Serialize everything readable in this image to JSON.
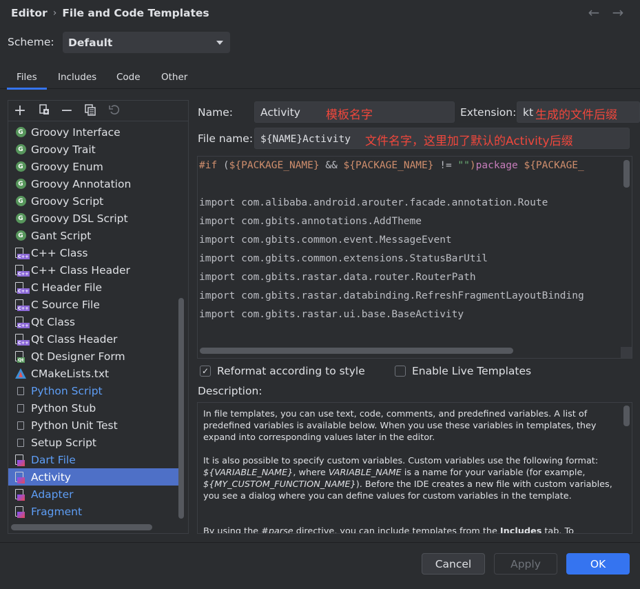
{
  "header": {
    "section": "Editor",
    "separator": "›",
    "page": "File and Code Templates",
    "back_icon": "←",
    "forward_icon": "→"
  },
  "scheme": {
    "label": "Scheme:",
    "value": "Default"
  },
  "tabs": [
    {
      "label": "Files"
    },
    {
      "label": "Includes"
    },
    {
      "label": "Code"
    },
    {
      "label": "Other"
    }
  ],
  "toolbar": {
    "add": "+",
    "remove": "−"
  },
  "templates": [
    {
      "label": "Groovy Interface",
      "icon": "groovy"
    },
    {
      "label": "Groovy Trait",
      "icon": "groovy"
    },
    {
      "label": "Groovy Enum",
      "icon": "groovy"
    },
    {
      "label": "Groovy Annotation",
      "icon": "groovy"
    },
    {
      "label": "Groovy Script",
      "icon": "groovy"
    },
    {
      "label": "Groovy DSL Script",
      "icon": "groovy"
    },
    {
      "label": "Gant Script",
      "icon": "groovy"
    },
    {
      "label": "C++ Class",
      "icon": "cpp"
    },
    {
      "label": "C++ Class Header",
      "icon": "cpp"
    },
    {
      "label": "C Header File",
      "icon": "cpp"
    },
    {
      "label": "C Source File",
      "icon": "cpp"
    },
    {
      "label": "Qt Class",
      "icon": "cpp"
    },
    {
      "label": "Qt Class Header",
      "icon": "cpp"
    },
    {
      "label": "Qt Designer Form",
      "icon": "qt"
    },
    {
      "label": "CMakeLists.txt",
      "icon": "cmake"
    },
    {
      "label": "Python Script",
      "icon": "python"
    },
    {
      "label": "Python Stub",
      "icon": "python"
    },
    {
      "label": "Python Unit Test",
      "icon": "python"
    },
    {
      "label": "Setup Script",
      "icon": "python"
    },
    {
      "label": "Dart File",
      "icon": "kotlin"
    },
    {
      "label": "Activity",
      "icon": "kotlin"
    },
    {
      "label": "Adapter",
      "icon": "kotlin"
    },
    {
      "label": "Fragment",
      "icon": "kotlin"
    }
  ],
  "icon_text": {
    "groovy": "G",
    "cpp": "C++",
    "qt": "Qt"
  },
  "form": {
    "name_label": "Name:",
    "name_value": "Activity",
    "name_annotation": "模板名字",
    "extension_label": "Extension:",
    "extension_value": "kt",
    "extension_annotation": "生成的文件后缀",
    "filename_label": "File name:",
    "filename_value": "${NAME}Activity",
    "filename_annotation": "文件名字，这里加了默认的Activity后缀"
  },
  "code": {
    "line1": {
      "kw1": "#if",
      "p1": " (",
      "v1": "${PACKAGE_NAME}",
      "p2": " && ",
      "v2": "${PACKAGE_NAME}",
      "p3": " != ",
      "s1": "\"\"",
      "p4": ")",
      "kw2": "package",
      "p5": " ",
      "v3": "${PACKAGE_"
    },
    "imports": [
      "import com.alibaba.android.arouter.facade.annotation.Route",
      "import com.gbits.annotations.AddTheme",
      "import com.gbits.common.event.MessageEvent",
      "import com.gbits.common.extensions.StatusBarUtil",
      "import com.gbits.rastar.data.router.RouterPath",
      "import com.gbits.rastar.databinding.RefreshFragmentLayoutBinding",
      "import com.gbits.rastar.ui.base.BaseActivity"
    ]
  },
  "options": {
    "reformat_label": "Reformat according to style",
    "reformat_checked": "✓",
    "live_label": "Enable Live Templates"
  },
  "description": {
    "label": "Description:",
    "p1": "In file templates, you can use text, code, comments, and predefined variables. A list of predefined variables is available below. When you use these variables in templates, they expand into corresponding values later in the editor.",
    "p2a": "It is also possible to specify custom variables. Custom variables use the following format: ",
    "p2b": "${VARIABLE_NAME}",
    "p2c": ", where ",
    "p2d": "VARIABLE_NAME",
    "p2e": " is a name for your variable (for example, ",
    "p2f": "${MY_CUSTOM_FUNCTION_NAME}",
    "p2g": "). Before the IDE creates a new file with custom variables, you see a dialog where you can define values for custom variables in the template.",
    "p3a": "By using the ",
    "p3b": "#parse",
    "p3c": " directive, you can include templates from the ",
    "p3d": "Includes",
    "p3e": " tab. To"
  },
  "buttons": {
    "cancel": "Cancel",
    "apply": "Apply",
    "ok": "OK"
  },
  "colors": {
    "accent": "#3574f0",
    "selection": "#4e70c7",
    "annotation_red": "#f0473c",
    "link_blue": "#5e9ef6"
  }
}
